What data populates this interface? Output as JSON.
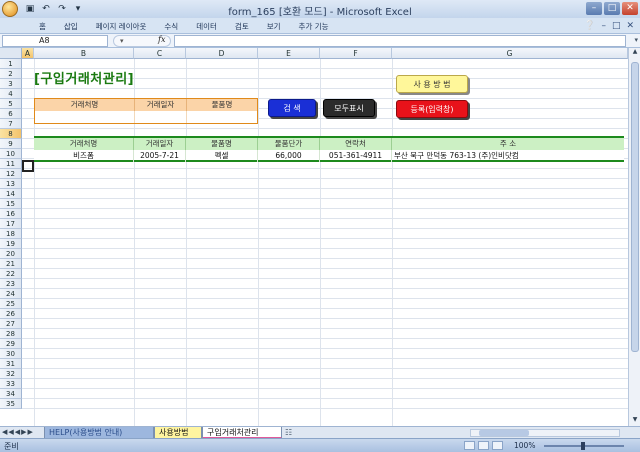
{
  "window": {
    "title": "form_165  [호환 모드] - Microsoft Excel",
    "controls": [
      "minimize-button",
      "maximize-button",
      "close-button"
    ]
  },
  "ribbon": {
    "tabs": [
      "홈",
      "삽입",
      "페이지 레이아웃",
      "수식",
      "데이터",
      "검토",
      "보기",
      "추가 기능"
    ]
  },
  "formula_bar": {
    "name_box": "A8",
    "fx_label": "fx",
    "content": ""
  },
  "columns": [
    "A",
    "B",
    "C",
    "D",
    "E",
    "F",
    "G"
  ],
  "rows": [
    "1",
    "2",
    "3",
    "4",
    "5",
    "6",
    "7",
    "8",
    "9",
    "10",
    "11",
    "12",
    "13",
    "14",
    "15",
    "16",
    "17",
    "18",
    "19",
    "20",
    "21",
    "22",
    "23",
    "24",
    "25",
    "26",
    "27",
    "28",
    "29",
    "30",
    "31",
    "32",
    "33",
    "34",
    "35"
  ],
  "sheet": {
    "title": "[구입거래처관리]",
    "search_headers": [
      "거래처명",
      "거래일자",
      "물품명"
    ],
    "buttons": {
      "search": "검  색",
      "show_all": "모두표시",
      "howto": "사 용 방 법",
      "register": "등록(입력창)"
    },
    "table_headers": [
      "거래처명",
      "거래일자",
      "물품명",
      "물품단가",
      "연락처",
      "주      소"
    ],
    "table_rows": [
      [
        "비즈폼",
        "2005-7-21",
        "펙셀",
        "66,000",
        "051-361-4911",
        "부산 북구 만덕동 763-13 (주)인비닷컴"
      ]
    ]
  },
  "sheet_tabs": {
    "first": "HELP(사용방법 안내)",
    "second": "사용방법",
    "third": "구입거래처관리"
  },
  "status": {
    "ready": "준비",
    "zoom": "100%"
  },
  "colors": {
    "title_green": "#1a7a10",
    "search_blue": "#1a2fd6",
    "register_red": "#e8121a",
    "howto_yellow": "#fff79a",
    "table_border_green": "#1d8a1d"
  }
}
